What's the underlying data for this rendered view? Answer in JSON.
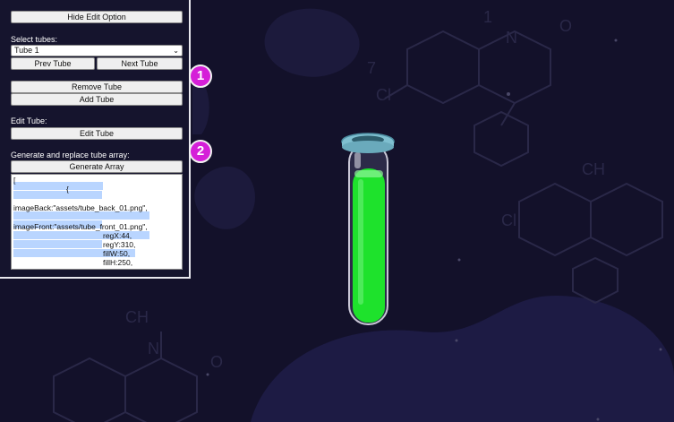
{
  "panel": {
    "hide_edit_label": "Hide Edit Option",
    "select_tubes_label": "Select tubes:",
    "selected_tube": "Tube 1",
    "prev_label": "Prev Tube",
    "next_label": "Next Tube",
    "remove_label": "Remove Tube",
    "add_label": "Add Tube",
    "edit_tube_label": "Edit Tube:",
    "edit_button_label": "Edit Tube",
    "generate_label": "Generate and replace tube array:",
    "generate_button_label": "Generate Array",
    "array_lines": [
      "[",
      "                         {",
      "imageBack:\"assets/tube_back_01.png\",",
      "imageFront:\"assets/tube_front_01.png\",",
      "regX:44,",
      "regY:310,",
      "fillW:50,",
      "fillH:250,"
    ]
  },
  "badges": [
    "1",
    "2"
  ],
  "colors": {
    "background": "#13112a",
    "liquid": "#1ee22c",
    "tube_rim": "#7fbfd0",
    "badge": "#d51fd8"
  }
}
